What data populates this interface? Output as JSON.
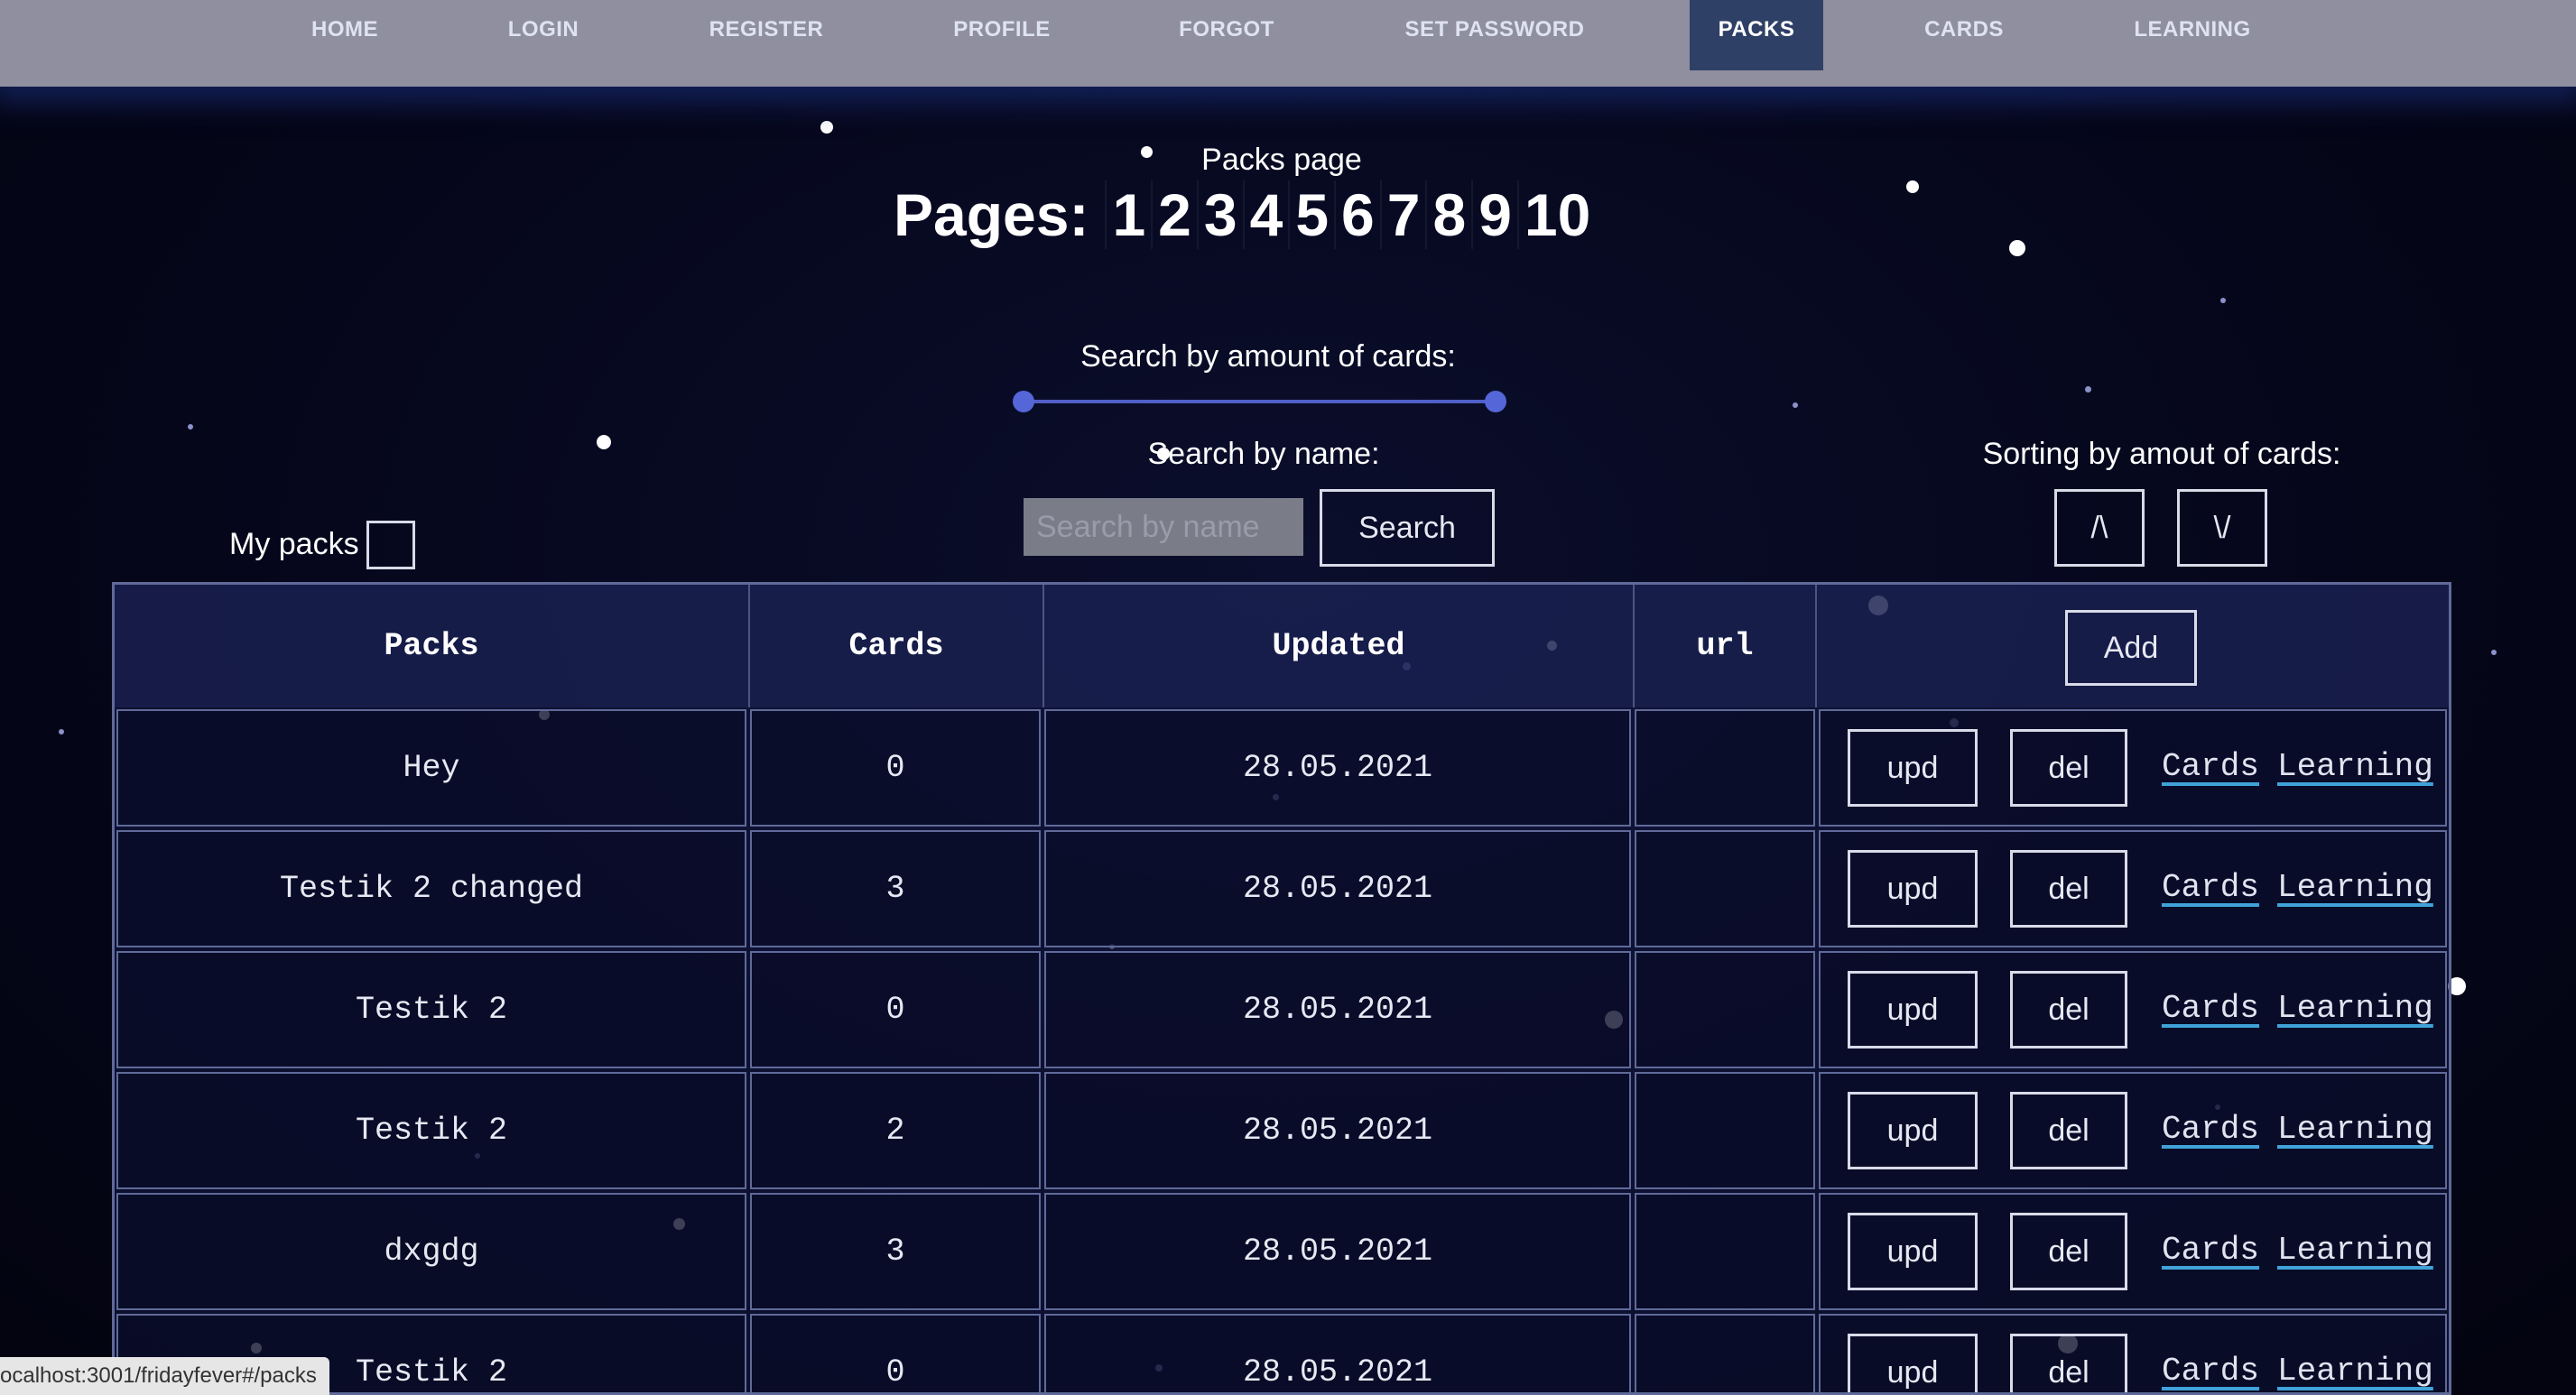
{
  "nav": {
    "items": [
      "HOME",
      "LOGIN",
      "REGISTER",
      "PROFILE",
      "FORGOT",
      "SET PASSWORD",
      "PACKS",
      "CARDS",
      "LEARNING"
    ],
    "active": "PACKS"
  },
  "page": {
    "title": "Packs page",
    "pages_label": "Pages:",
    "pages": [
      "1",
      "2",
      "3",
      "4",
      "5",
      "6",
      "7",
      "8",
      "9",
      "10"
    ]
  },
  "filters": {
    "amount_label": "Search by amount of cards:",
    "name_label": "Search by name:",
    "search_placeholder": "Search by name",
    "search_value": "",
    "search_button": "Search",
    "sort_label": "Sorting by amout of cards:",
    "sort_up": "/\\",
    "sort_down": "\\/",
    "my_packs_label": "My packs",
    "my_packs_checked": false
  },
  "table": {
    "headers": [
      "Packs",
      "Cards",
      "Updated",
      "url"
    ],
    "add_button": "Add",
    "row_actions": {
      "upd": "upd",
      "del": "del",
      "cards": "Cards",
      "learning": "Learning"
    },
    "rows": [
      {
        "pack": "Hey",
        "cards": "0",
        "updated": "28.05.2021",
        "url": ""
      },
      {
        "pack": "Testik 2 changed",
        "cards": "3",
        "updated": "28.05.2021",
        "url": ""
      },
      {
        "pack": "Testik 2",
        "cards": "0",
        "updated": "28.05.2021",
        "url": ""
      },
      {
        "pack": "Testik 2",
        "cards": "2",
        "updated": "28.05.2021",
        "url": ""
      },
      {
        "pack": "dxgdg",
        "cards": "3",
        "updated": "28.05.2021",
        "url": ""
      },
      {
        "pack": "Testik 2",
        "cards": "0",
        "updated": "28.05.2021",
        "url": ""
      }
    ]
  },
  "status_bar": {
    "url": "ocalhost:3001/fridayfever#/packs"
  },
  "colors": {
    "nav_bg": "#8f8fa0",
    "nav_active_bg": "#2f4066",
    "page_bg": "#05061a",
    "slider": "#5566d8",
    "link_underline": "#3fa2d8",
    "table_border": "#5f6a99"
  }
}
